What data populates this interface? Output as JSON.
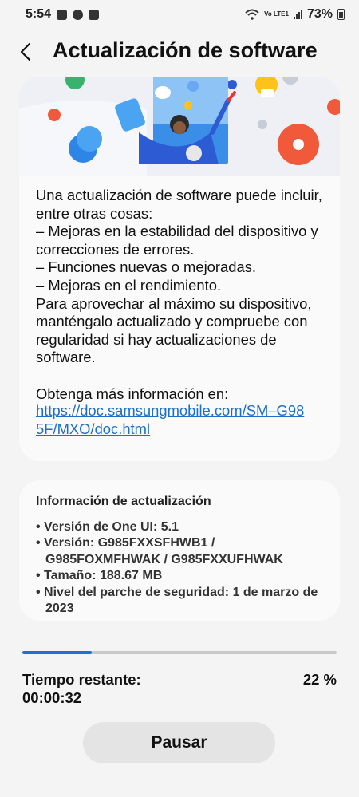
{
  "status_bar": {
    "time": "5:54",
    "network": "Vo LTE1",
    "battery": "73%"
  },
  "header": {
    "title": "Actualización de software"
  },
  "intro": {
    "description": "Una actualización de software puede incluir, entre otras cosas:\n – Mejoras en la estabilidad del dispositivo y correcciones de errores.\n – Funciones nuevas o mejoradas.\n – Mejoras en el rendimiento.\nPara aprovechar al máximo su dispositivo, manténgalo actualizado y compruebe con regularidad si hay actualizaciones de software.",
    "more_info_label": "Obtenga más información en:",
    "link": "https://doc.samsungmobile.com/SM–G985F/MXO/doc.html"
  },
  "update_info": {
    "title": "Información de actualización",
    "items": [
      "Versión de One UI: 5.1",
      "Versión: G985FXXSFHWB1 / G985FOXMFHWAK / G985FXXUFHWAK",
      "Tamaño: 188.67 MB",
      "Nivel del parche de seguridad: 1 de marzo de 2023"
    ]
  },
  "progress": {
    "fraction": 0.22,
    "remaining_label": "Tiempo restante:",
    "remaining_time": "00:00:32",
    "percent_text": "22 %"
  },
  "actions": {
    "pause_label": "Pausar"
  }
}
